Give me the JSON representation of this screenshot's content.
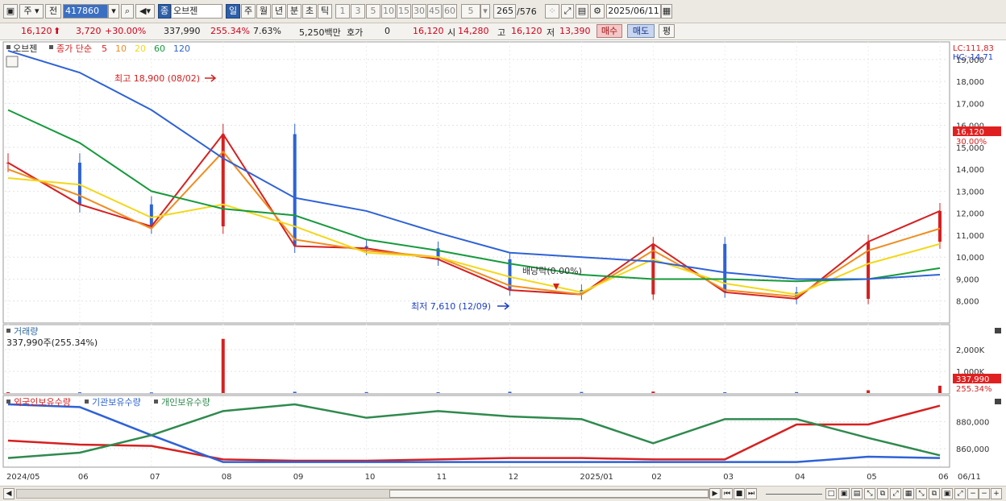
{
  "toolbar": {
    "period": "주",
    "prev_label": "전",
    "code": "417860",
    "name_badge": "종",
    "name": "오브젠",
    "intervals": [
      "일",
      "주",
      "월",
      "년",
      "분",
      "초",
      "틱"
    ],
    "minute_steps": [
      "1",
      "3",
      "5",
      "10",
      "15",
      "30",
      "45",
      "60"
    ],
    "step_value": "5",
    "range_value": "265",
    "range_total": "/576",
    "date": "2025/06/11"
  },
  "quote": {
    "price": "16,120",
    "change": "3,720",
    "change_pct": "+30.00%",
    "volume": "337,990",
    "vol_ratio": "255.34%",
    "turnover": "7.63%",
    "amount": "5,250백만",
    "hoga_label": "호가",
    "hoga_value": "0",
    "bid_price": "16,120",
    "open_label": "시",
    "open_value": "14,280",
    "high_label": "고",
    "high_value": "16,120",
    "low_label": "저",
    "low_value": "13,390",
    "buy_label": "매수",
    "sell_label": "매도",
    "eval_label": "평"
  },
  "price_panel": {
    "legend_name": "오브젠",
    "legend_ma_label": "종가 단순",
    "legend_periods": [
      {
        "label": "5",
        "color": "#d62020"
      },
      {
        "label": "10",
        "color": "#f08c1e"
      },
      {
        "label": "20",
        "color": "#f2d81a"
      },
      {
        "label": "60",
        "color": "#169a3c"
      },
      {
        "label": "120",
        "color": "#2e62d6"
      }
    ],
    "lc": "LC:111,83",
    "hc": "HC:-14,71",
    "high_annotation": "최고 18,900 (08/02)",
    "low_annotation": "최저 7,610 (12/09)",
    "dividend_annotation": "배당락(0.00%)",
    "yaxis_labels": [
      "19,000",
      "18,000",
      "17,000",
      "16,000",
      "15,000",
      "14,000",
      "13,000",
      "12,000",
      "11,000",
      "10,000",
      "9,000",
      "8,000"
    ],
    "price_tag": "16,120",
    "pct_tag": "30.00%"
  },
  "volume_panel": {
    "title": "거래량",
    "value": "337,990주(255.34%)",
    "yaxis_labels": [
      "2,000K",
      "1,000K"
    ],
    "tag": "337,990",
    "pct_tag": "255.34%"
  },
  "holdings_panel": {
    "legend": [
      {
        "label": "외국인보유수량",
        "color": "#d62020"
      },
      {
        "label": "기관보유수량",
        "color": "#2e62d6"
      },
      {
        "label": "개인보유수량",
        "color": "#2f8a4e"
      }
    ],
    "yaxis_labels": [
      "880,000",
      "860,000"
    ]
  },
  "x_axis_labels": [
    "2024/05",
    "06",
    "07",
    "08",
    "09",
    "10",
    "11",
    "12",
    "2025/01",
    "02",
    "03",
    "04",
    "05",
    "06",
    "06/11"
  ],
  "chart_data": {
    "type": "line",
    "title": "",
    "xlabel": "",
    "ylabel": "",
    "ylim": [
      7000,
      19800
    ],
    "x": [
      "2024/05",
      "06",
      "07",
      "08",
      "09",
      "10",
      "11",
      "12",
      "2025/01",
      "02",
      "03",
      "04",
      "05",
      "06"
    ],
    "series": [
      {
        "name": "5",
        "values": [
          14300,
          12400,
          11400,
          15600,
          10500,
          10400,
          9900,
          8500,
          8300,
          10600,
          8400,
          8100,
          10700,
          12100
        ]
      },
      {
        "name": "10",
        "values": [
          14000,
          12800,
          11300,
          14800,
          10800,
          10300,
          10000,
          8700,
          8300,
          10300,
          8500,
          8200,
          10300,
          11300
        ]
      },
      {
        "name": "20",
        "values": [
          13600,
          13300,
          11800,
          12400,
          11400,
          10200,
          10000,
          9100,
          8400,
          9900,
          8800,
          8300,
          9700,
          10600
        ]
      },
      {
        "name": "60",
        "values": [
          16700,
          15200,
          13000,
          12200,
          11900,
          10800,
          10300,
          9700,
          9200,
          9000,
          9000,
          8900,
          9000,
          9500
        ]
      },
      {
        "name": "120",
        "values": [
          19400,
          18400,
          16700,
          14500,
          12700,
          12100,
          11100,
          10200,
          10000,
          9800,
          9300,
          9000,
          9000,
          9200
        ]
      }
    ],
    "volume": {
      "labels": [
        "2024/05",
        "06",
        "07",
        "08",
        "09",
        "10",
        "11",
        "12",
        "2025/01",
        "02",
        "03",
        "04",
        "05",
        "06"
      ],
      "values": [
        40,
        35,
        30,
        2500,
        60,
        45,
        40,
        60,
        50,
        70,
        40,
        45,
        130,
        338
      ]
    },
    "holdings": [
      {
        "name": "외국인보유수량",
        "values": [
          866,
          863,
          862,
          852,
          851,
          851,
          852,
          853,
          853,
          852,
          852,
          878,
          878,
          892
        ]
      },
      {
        "name": "기관보유수량",
        "values": [
          893,
          891,
          870,
          850,
          850,
          850,
          850,
          850,
          850,
          850,
          850,
          850,
          854,
          853
        ]
      },
      {
        "name": "개인보유수량",
        "values": [
          853,
          857,
          870,
          888,
          893,
          883,
          888,
          884,
          882,
          864,
          882,
          882,
          868,
          855
        ]
      }
    ]
  }
}
